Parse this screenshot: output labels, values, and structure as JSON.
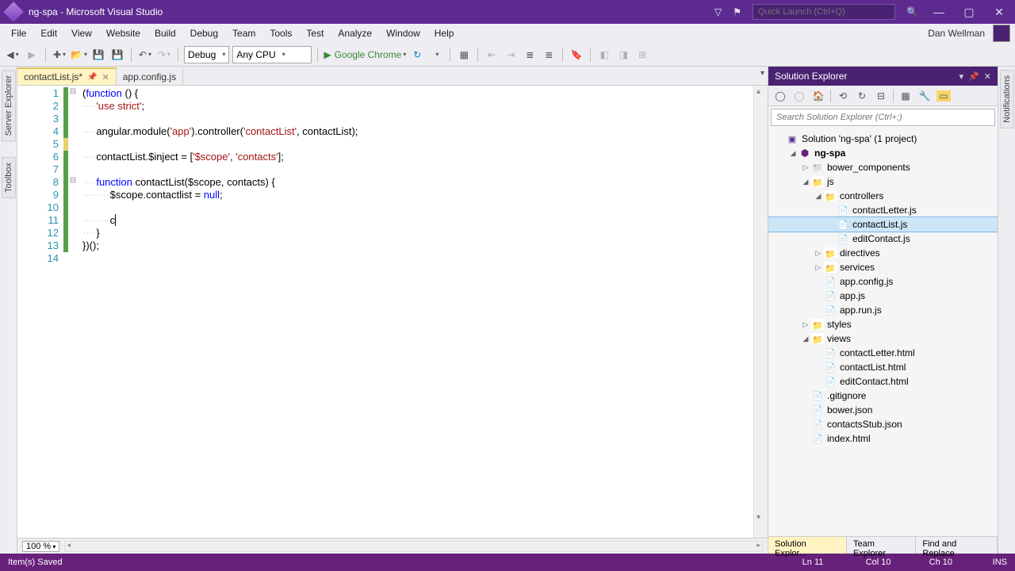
{
  "window": {
    "title": "ng-spa - Microsoft Visual Studio"
  },
  "quicklaunch": {
    "placeholder": "Quick Launch (Ctrl+Q)"
  },
  "menu": {
    "items": [
      "File",
      "Edit",
      "View",
      "Website",
      "Build",
      "Debug",
      "Team",
      "Tools",
      "Test",
      "Analyze",
      "Window",
      "Help"
    ],
    "user": "Dan Wellman"
  },
  "toolbar": {
    "debug": "Debug",
    "cpu": "Any CPU",
    "browser": "Google Chrome"
  },
  "left_tabs": [
    "Server Explorer",
    "Toolbox"
  ],
  "right_tabs": [
    "Notifications"
  ],
  "editor": {
    "tabs": [
      {
        "label": "contactList.js*",
        "active": true
      },
      {
        "label": "app.config.js",
        "active": false
      }
    ],
    "zoom": "100 %",
    "code": {
      "lines": [
        1,
        2,
        3,
        4,
        5,
        6,
        7,
        8,
        9,
        10,
        11,
        12,
        13,
        14
      ],
      "fold": {
        "1": "⊟",
        "8": "⊟"
      },
      "change": {
        "1": "g",
        "2": "g",
        "3": "g",
        "4": "g",
        "5": "y",
        "6": "g",
        "7": "g",
        "8": "g",
        "9": "g",
        "10": "g",
        "11": "g",
        "12": "g",
        "13": "g"
      },
      "l1a": "(",
      "l1b": "function",
      "l1c": " () {",
      "l2a": "····",
      "l2b": "'use strict'",
      "l2c": ";",
      "l4a": "····angular.module(",
      "l4b": "'app'",
      "l4c": ").controller(",
      "l4d": "'contactList'",
      "l4e": ", contactList);",
      "l6a": "····contactList.$inject = [",
      "l6b": "'$scope'",
      "l6c": ", ",
      "l6d": "'contacts'",
      "l6e": "];",
      "l8a": "····",
      "l8b": "function",
      "l8c": " contactList($scope, contacts) {",
      "l9a": "········$scope.contactlist = ",
      "l9b": "null",
      "l9c": ";",
      "l11a": "········c",
      "l12a": "····}",
      "l13a": "})();"
    }
  },
  "solex": {
    "title": "Solution Explorer",
    "search_placeholder": "Search Solution Explorer (Ctrl+;)",
    "solution": "Solution 'ng-spa' (1 project)",
    "project": "ng-spa",
    "folders": {
      "bower": "bower_components",
      "js": "js",
      "controllers": "controllers",
      "directives": "directives",
      "services": "services",
      "styles": "styles",
      "views": "views"
    },
    "files": {
      "contactLetter_js": "contactLetter.js",
      "contactList_js": "contactList.js",
      "editContact_js": "editContact.js",
      "app_config": "app.config.js",
      "app_js": "app.js",
      "app_run": "app.run.js",
      "contactLetter_html": "contactLetter.html",
      "contactList_html": "contactList.html",
      "editContact_html": "editContact.html",
      "gitignore": ".gitignore",
      "bower_json": "bower.json",
      "contactsStub": "contactsStub.json",
      "index": "index.html"
    },
    "bottom_tabs": [
      "Solution Explor...",
      "Team Explorer",
      "Find and Replace"
    ]
  },
  "status": {
    "left": "Item(s) Saved",
    "ln": "Ln 11",
    "col": "Col 10",
    "ch": "Ch 10",
    "ins": "INS"
  }
}
